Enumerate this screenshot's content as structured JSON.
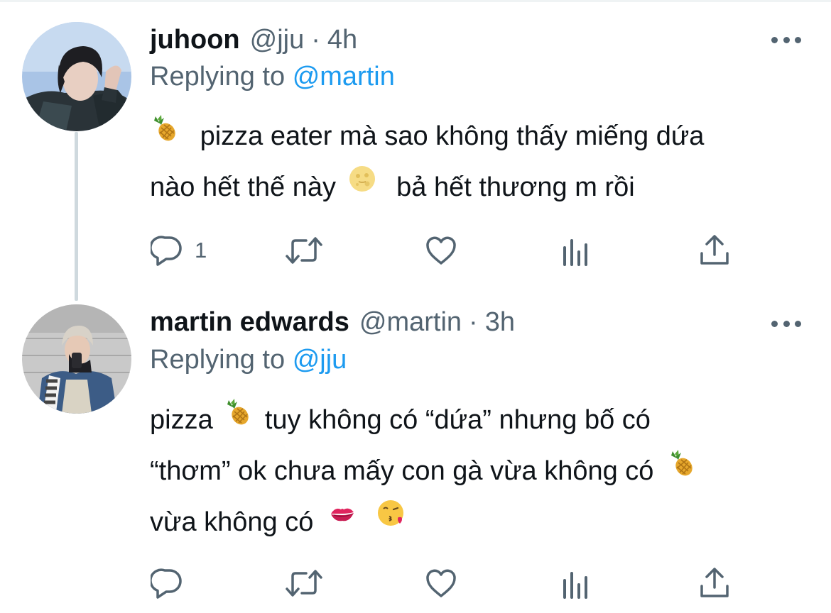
{
  "tweets": [
    {
      "name": "juhoon",
      "handle": "@jju",
      "separator": "·",
      "time": "4h",
      "replying_label": "Replying to",
      "replying_to": "@martin",
      "body_line1": "pizza eater mà sao không thấy miếng dứa",
      "body_line2_a": "nào hết thế này",
      "body_line2_b": "bả hết thương m rồi",
      "reply_count": "1",
      "emoji": [
        "pineapple-emoji",
        "moon-face-emoji"
      ]
    },
    {
      "name": "martin edwards",
      "handle": "@martin",
      "separator": "·",
      "time": "3h",
      "replying_label": "Replying to",
      "replying_to": "@jju",
      "body_line1_a": "pizza",
      "body_line1_b": "tuy không có “dứa” nhưng bố có",
      "body_line2": "“thơm” ok chưa mấy con gà vừa không có",
      "body_line3": "vừa không có",
      "reply_count": "",
      "emoji": [
        "pineapple-emoji",
        "pineapple-emoji",
        "kiss-mark-emoji",
        "face-blowing-kiss-emoji"
      ]
    }
  ],
  "colors": {
    "text": "#0f1419",
    "secondary": "#536471",
    "link": "#1d9bf0",
    "thread_line": "#cfd9de"
  },
  "icons": [
    "reply-icon",
    "retweet-icon",
    "like-icon",
    "analytics-icon",
    "share-icon",
    "more-icon"
  ]
}
